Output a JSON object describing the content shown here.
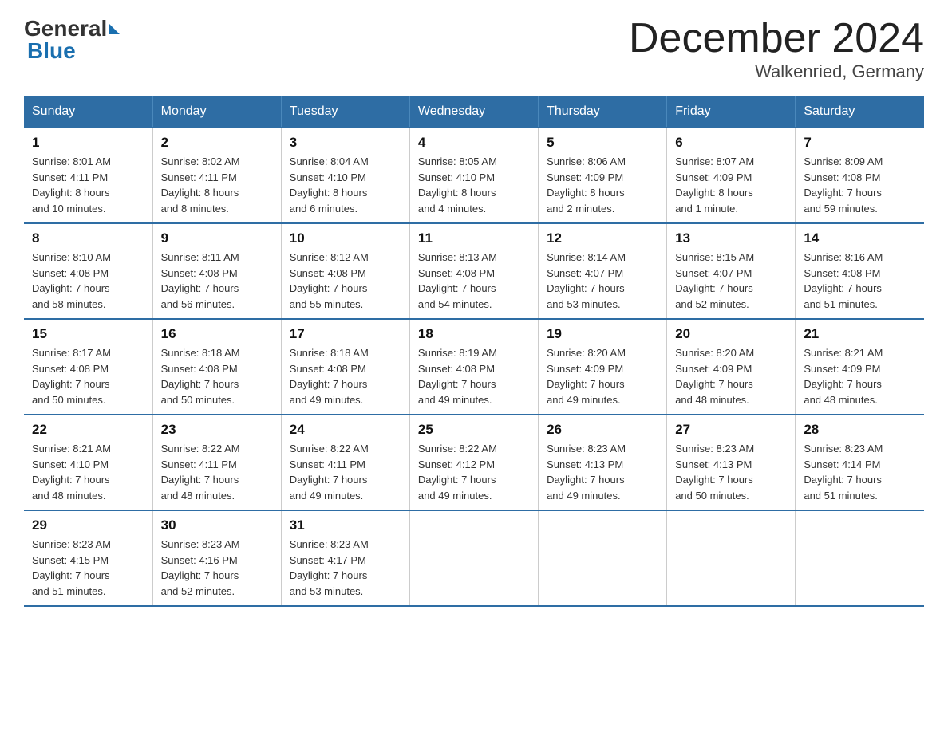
{
  "logo": {
    "general": "General",
    "blue": "Blue"
  },
  "title": "December 2024",
  "subtitle": "Walkenried, Germany",
  "headers": [
    "Sunday",
    "Monday",
    "Tuesday",
    "Wednesday",
    "Thursday",
    "Friday",
    "Saturday"
  ],
  "weeks": [
    [
      {
        "day": "1",
        "info": "Sunrise: 8:01 AM\nSunset: 4:11 PM\nDaylight: 8 hours\nand 10 minutes."
      },
      {
        "day": "2",
        "info": "Sunrise: 8:02 AM\nSunset: 4:11 PM\nDaylight: 8 hours\nand 8 minutes."
      },
      {
        "day": "3",
        "info": "Sunrise: 8:04 AM\nSunset: 4:10 PM\nDaylight: 8 hours\nand 6 minutes."
      },
      {
        "day": "4",
        "info": "Sunrise: 8:05 AM\nSunset: 4:10 PM\nDaylight: 8 hours\nand 4 minutes."
      },
      {
        "day": "5",
        "info": "Sunrise: 8:06 AM\nSunset: 4:09 PM\nDaylight: 8 hours\nand 2 minutes."
      },
      {
        "day": "6",
        "info": "Sunrise: 8:07 AM\nSunset: 4:09 PM\nDaylight: 8 hours\nand 1 minute."
      },
      {
        "day": "7",
        "info": "Sunrise: 8:09 AM\nSunset: 4:08 PM\nDaylight: 7 hours\nand 59 minutes."
      }
    ],
    [
      {
        "day": "8",
        "info": "Sunrise: 8:10 AM\nSunset: 4:08 PM\nDaylight: 7 hours\nand 58 minutes."
      },
      {
        "day": "9",
        "info": "Sunrise: 8:11 AM\nSunset: 4:08 PM\nDaylight: 7 hours\nand 56 minutes."
      },
      {
        "day": "10",
        "info": "Sunrise: 8:12 AM\nSunset: 4:08 PM\nDaylight: 7 hours\nand 55 minutes."
      },
      {
        "day": "11",
        "info": "Sunrise: 8:13 AM\nSunset: 4:08 PM\nDaylight: 7 hours\nand 54 minutes."
      },
      {
        "day": "12",
        "info": "Sunrise: 8:14 AM\nSunset: 4:07 PM\nDaylight: 7 hours\nand 53 minutes."
      },
      {
        "day": "13",
        "info": "Sunrise: 8:15 AM\nSunset: 4:07 PM\nDaylight: 7 hours\nand 52 minutes."
      },
      {
        "day": "14",
        "info": "Sunrise: 8:16 AM\nSunset: 4:08 PM\nDaylight: 7 hours\nand 51 minutes."
      }
    ],
    [
      {
        "day": "15",
        "info": "Sunrise: 8:17 AM\nSunset: 4:08 PM\nDaylight: 7 hours\nand 50 minutes."
      },
      {
        "day": "16",
        "info": "Sunrise: 8:18 AM\nSunset: 4:08 PM\nDaylight: 7 hours\nand 50 minutes."
      },
      {
        "day": "17",
        "info": "Sunrise: 8:18 AM\nSunset: 4:08 PM\nDaylight: 7 hours\nand 49 minutes."
      },
      {
        "day": "18",
        "info": "Sunrise: 8:19 AM\nSunset: 4:08 PM\nDaylight: 7 hours\nand 49 minutes."
      },
      {
        "day": "19",
        "info": "Sunrise: 8:20 AM\nSunset: 4:09 PM\nDaylight: 7 hours\nand 49 minutes."
      },
      {
        "day": "20",
        "info": "Sunrise: 8:20 AM\nSunset: 4:09 PM\nDaylight: 7 hours\nand 48 minutes."
      },
      {
        "day": "21",
        "info": "Sunrise: 8:21 AM\nSunset: 4:09 PM\nDaylight: 7 hours\nand 48 minutes."
      }
    ],
    [
      {
        "day": "22",
        "info": "Sunrise: 8:21 AM\nSunset: 4:10 PM\nDaylight: 7 hours\nand 48 minutes."
      },
      {
        "day": "23",
        "info": "Sunrise: 8:22 AM\nSunset: 4:11 PM\nDaylight: 7 hours\nand 48 minutes."
      },
      {
        "day": "24",
        "info": "Sunrise: 8:22 AM\nSunset: 4:11 PM\nDaylight: 7 hours\nand 49 minutes."
      },
      {
        "day": "25",
        "info": "Sunrise: 8:22 AM\nSunset: 4:12 PM\nDaylight: 7 hours\nand 49 minutes."
      },
      {
        "day": "26",
        "info": "Sunrise: 8:23 AM\nSunset: 4:13 PM\nDaylight: 7 hours\nand 49 minutes."
      },
      {
        "day": "27",
        "info": "Sunrise: 8:23 AM\nSunset: 4:13 PM\nDaylight: 7 hours\nand 50 minutes."
      },
      {
        "day": "28",
        "info": "Sunrise: 8:23 AM\nSunset: 4:14 PM\nDaylight: 7 hours\nand 51 minutes."
      }
    ],
    [
      {
        "day": "29",
        "info": "Sunrise: 8:23 AM\nSunset: 4:15 PM\nDaylight: 7 hours\nand 51 minutes."
      },
      {
        "day": "30",
        "info": "Sunrise: 8:23 AM\nSunset: 4:16 PM\nDaylight: 7 hours\nand 52 minutes."
      },
      {
        "day": "31",
        "info": "Sunrise: 8:23 AM\nSunset: 4:17 PM\nDaylight: 7 hours\nand 53 minutes."
      },
      null,
      null,
      null,
      null
    ]
  ]
}
